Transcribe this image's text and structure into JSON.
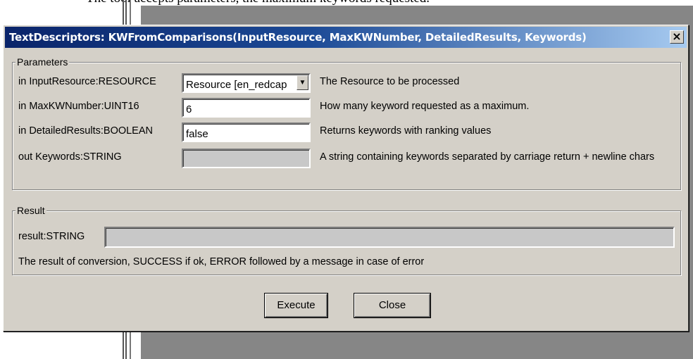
{
  "background": {
    "caption_fragment": "The tool accepts parameters, the maximum keywords requested."
  },
  "dialog": {
    "title": "TextDescriptors: KWFromComparisons(InputResource, MaxKWNumber, DetailedResults, Keywords)",
    "close_glyph": "×"
  },
  "parameters": {
    "legend": "Parameters",
    "rows": [
      {
        "label": "in InputResource:RESOURCE",
        "value": "Resource [en_redcap",
        "description": "The Resource to be processed"
      },
      {
        "label": "in MaxKWNumber:UINT16",
        "value": "6",
        "description": "How many keyword requested as a maximum."
      },
      {
        "label": "in DetailedResults:BOOLEAN",
        "value": "false",
        "description": "Returns keywords with ranking values"
      },
      {
        "label": "out Keywords:STRING",
        "value": "",
        "description": "A string containing keywords separated by carriage return + newline chars"
      }
    ]
  },
  "result": {
    "legend": "Result",
    "label": "result:STRING",
    "value": "",
    "description": "The result of conversion, SUCCESS if ok, ERROR followed by a message in case of error"
  },
  "buttons": {
    "execute": "Execute",
    "close": "Close"
  },
  "colors": {
    "title_start": "#0a246a",
    "title_end": "#a6caf0",
    "dialog_face": "#d4d0c8",
    "backdrop": "#868686"
  },
  "icons": {
    "dropdown": "chevron-down-icon",
    "close": "close-icon"
  }
}
